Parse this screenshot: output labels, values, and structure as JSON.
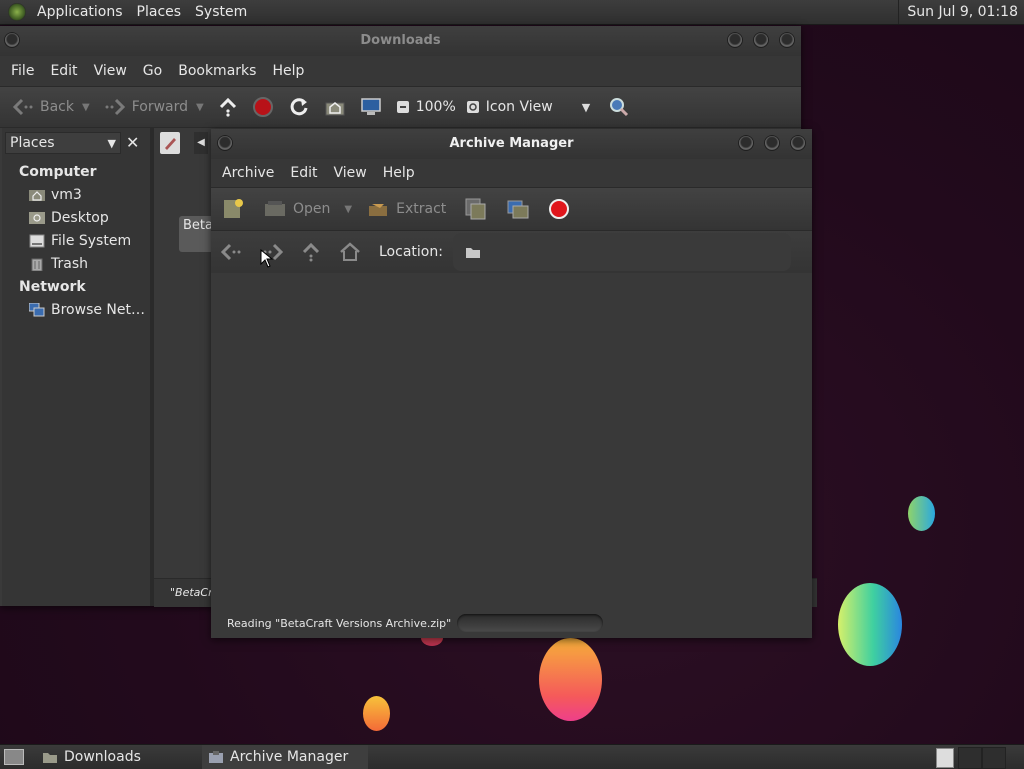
{
  "top_panel": {
    "menus": [
      "Applications",
      "Places",
      "System"
    ],
    "clock": "Sun Jul  9, 01:18"
  },
  "downloads_window": {
    "title": "Downloads",
    "menu": [
      "File",
      "Edit",
      "View",
      "Go",
      "Bookmarks",
      "Help"
    ],
    "toolbar": {
      "back": "Back",
      "forward": "Forward",
      "zoom": "100%",
      "view_mode": "Icon View"
    },
    "sidebar": {
      "selector": "Places",
      "sections": [
        {
          "heading": "Computer",
          "items": [
            {
              "label": "vm3",
              "icon": "home-folder-icon"
            },
            {
              "label": "Desktop",
              "icon": "desktop-icon"
            },
            {
              "label": "File System",
              "icon": "drive-icon"
            },
            {
              "label": "Trash",
              "icon": "trash-icon"
            }
          ]
        },
        {
          "heading": "Network",
          "items": [
            {
              "label": "Browse Net…",
              "icon": "network-icon"
            }
          ]
        }
      ]
    },
    "file_item_partial": "Beta",
    "status_partial": "\"BetaCra"
  },
  "archive_window": {
    "title": "Archive Manager",
    "menu": [
      "Archive",
      "Edit",
      "View",
      "Help"
    ],
    "toolbar": {
      "open": "Open",
      "extract": "Extract"
    },
    "location_label": "Location:",
    "location_value": "",
    "status": "Reading \"BetaCraft Versions Archive.zip\""
  },
  "taskbar": {
    "items": [
      {
        "label": "Downloads",
        "icon": "folder-icon"
      },
      {
        "label": "Archive Manager",
        "icon": "archive-icon"
      }
    ]
  },
  "colors": {
    "panel": "#353535",
    "window": "#3a3a3a",
    "stop_red": "#e0161c",
    "desktop": "#220a1c"
  }
}
